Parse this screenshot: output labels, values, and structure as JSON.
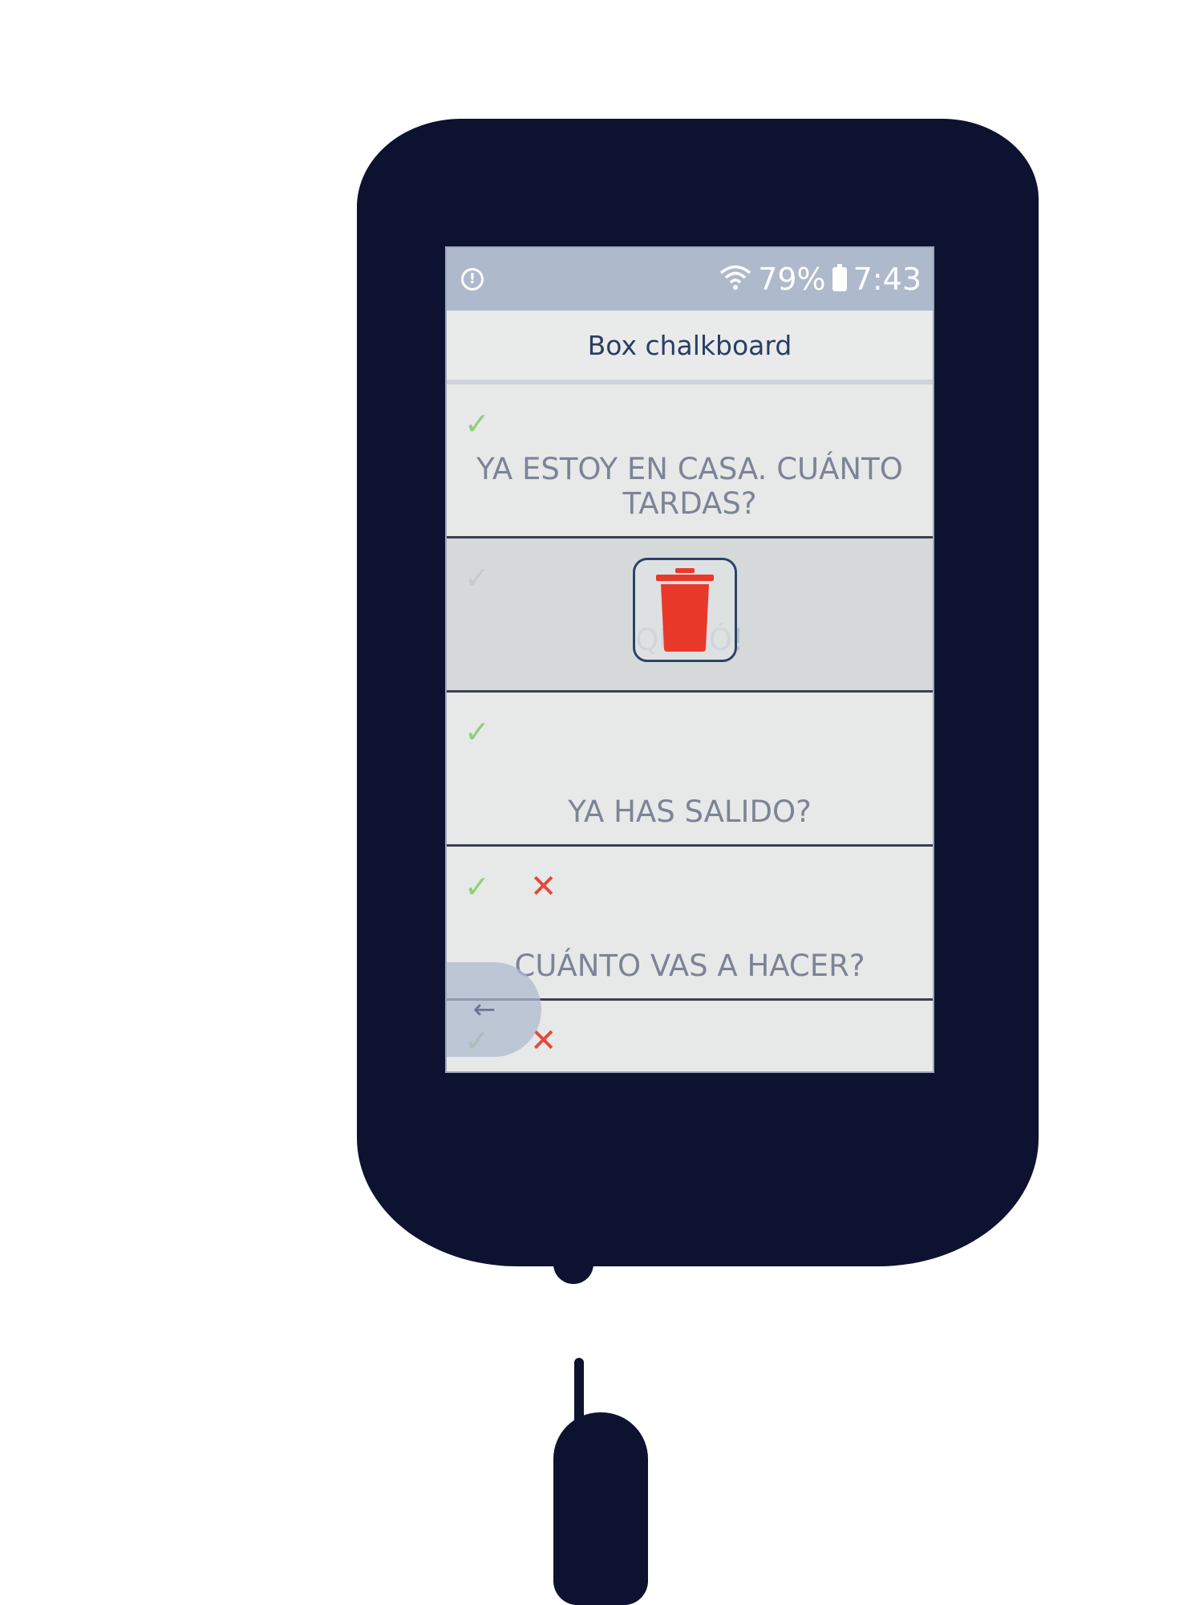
{
  "statusbar": {
    "alert_icon": "alert-circle-icon",
    "battery_percent": "79%",
    "time": "7:43"
  },
  "header": {
    "title": "Box chalkboard"
  },
  "messages": [
    {
      "text": "YA ESTOY EN CASA. CUÁNTO TARDAS?",
      "icons": [
        "check"
      ]
    },
    {
      "text": "QU...Ó!",
      "icons": [
        "check"
      ],
      "state": "selected-for-delete"
    },
    {
      "text": "YA HAS SALIDO?",
      "icons": [
        "check"
      ]
    },
    {
      "text": "CUÁNTO VAS A HACER?",
      "icons": [
        "check",
        "cross"
      ]
    },
    {
      "text": "",
      "icons": [
        "check",
        "cross"
      ]
    }
  ],
  "actions": {
    "delete_icon": "trash-icon",
    "back_icon": "back-arrow-icon"
  },
  "colors": {
    "check": "#8fcf7a",
    "cross": "#e04a3a",
    "trash": "#e8392a",
    "device": "#0d1230"
  }
}
